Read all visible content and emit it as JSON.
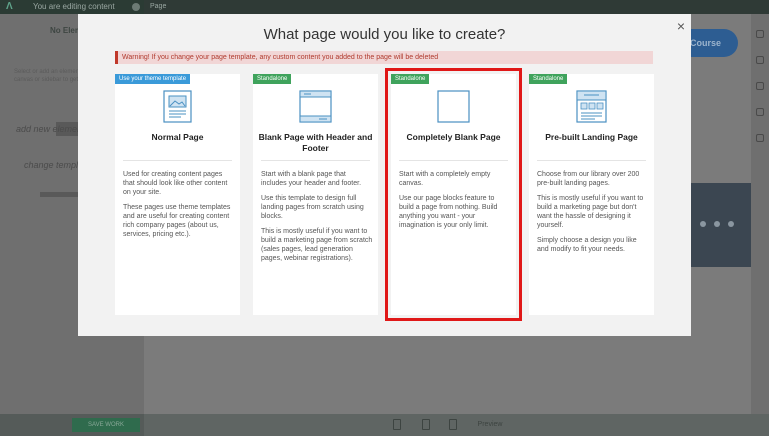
{
  "topbar": {
    "editing_label": "You are editing content",
    "page_tab_label": "Page"
  },
  "left_panel": {
    "heading": "No Element",
    "hint": "Select or add an element from the canvas or sidebar to get started",
    "annotation_1": "add new element",
    "annotation_2": "change template"
  },
  "background": {
    "course_button_label": "Course"
  },
  "bottombar": {
    "save_label": "SAVE WORK",
    "preview_label": "Preview"
  },
  "modal": {
    "title": "What page would you like to create?",
    "warning": "Warning! If you change your page template, any custom content you added to the page will be deleted",
    "cards": [
      {
        "badge": "Use your theme template",
        "badge_color": "#3a9ad9",
        "icon": "page-with-image-icon",
        "title": "Normal Page",
        "paragraphs": [
          "Used for creating content pages that should look like other content on your site.",
          "These pages use theme templates and are useful for creating content rich company pages (about us, services, pricing etc.)."
        ]
      },
      {
        "badge": "Standalone",
        "badge_color": "#3fa35c",
        "icon": "header-footer-page-icon",
        "title": "Blank Page with Header and Footer",
        "paragraphs": [
          "Start with a blank page that includes your header and footer.",
          "Use this template to design full landing pages from scratch using blocks.",
          "This is mostly useful if you want to build a marketing page from scratch (sales pages, lead generation pages, webinar registrations)."
        ]
      },
      {
        "badge": "Standalone",
        "badge_color": "#3fa35c",
        "icon": "blank-page-icon",
        "title": "Completely Blank Page",
        "paragraphs": [
          "Start with a completely empty canvas.",
          "Use our page blocks feature to build a page from nothing. Build anything you want - your imagination is your only limit."
        ]
      },
      {
        "badge": "Standalone",
        "badge_color": "#3fa35c",
        "icon": "landing-page-icon",
        "title": "Pre-built Landing Page",
        "paragraphs": [
          "Choose from our library over 200 pre-built landing pages.",
          "This is mostly useful if you want to build a marketing page but don't want the hassle of designing it yourself.",
          "Simply choose a design you like and modify to fit your needs."
        ]
      }
    ]
  }
}
